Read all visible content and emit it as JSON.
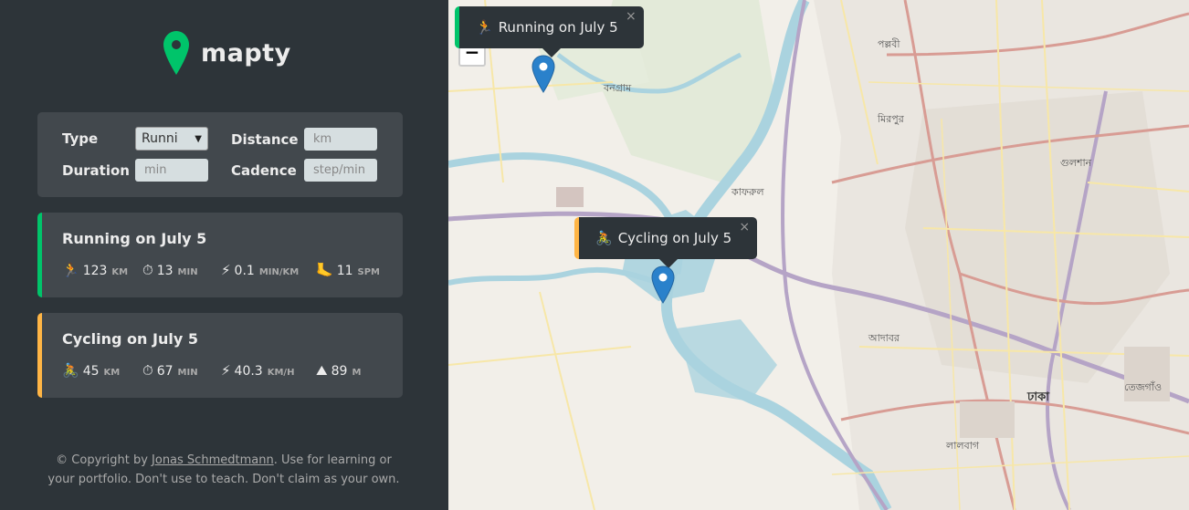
{
  "app": {
    "name": "mapty"
  },
  "form": {
    "type_label": "Type",
    "type_value": "Runni",
    "distance_label": "Distance",
    "distance_placeholder": "km",
    "duration_label": "Duration",
    "duration_placeholder": "min",
    "cadence_label": "Cadence",
    "cadence_placeholder": "step/min"
  },
  "workouts": [
    {
      "kind": "running",
      "accent": "#00c46a",
      "title": "Running on July 5",
      "details": [
        {
          "icon": "🏃",
          "value": "123",
          "unit": "km"
        },
        {
          "icon": "⏱",
          "value": "13",
          "unit": "min"
        },
        {
          "icon": "⚡",
          "value": "0.1",
          "unit": "min/km"
        },
        {
          "icon": "🦶",
          "value": "11",
          "unit": "spm"
        }
      ]
    },
    {
      "kind": "cycling",
      "accent": "#ffb545",
      "title": "Cycling on July 5",
      "details": [
        {
          "icon": "🚴",
          "value": "45",
          "unit": "km"
        },
        {
          "icon": "⏱",
          "value": "67",
          "unit": "min"
        },
        {
          "icon": "⚡",
          "value": "40.3",
          "unit": "km/h"
        },
        {
          "icon": "⛰",
          "value": "89",
          "unit": "m"
        }
      ]
    }
  ],
  "copyright": {
    "prefix": "© Copyright by ",
    "author": "Jonas Schmedtmann",
    "suffix": ". Use for learning or your portfolio. Don't use to teach. Don't claim as your own."
  },
  "map": {
    "zoom_in": "+",
    "zoom_out": "−",
    "popups": [
      {
        "title": "Running on July 5",
        "icon": "🏃",
        "close": "×"
      },
      {
        "title": "Cycling on July 5",
        "icon": "🚴",
        "close": "×"
      }
    ],
    "labels": [
      "পল্লবী",
      "মিরপুর",
      "কাফরুল",
      "ঢাকা",
      "গুলশান",
      "বনগ্রাম",
      "আদাবর",
      "তেজগাঁও",
      "লালবাগ"
    ]
  },
  "colors": {
    "sidebar_bg": "#2d3439",
    "card_bg": "#42484d",
    "running": "#00c46a",
    "cycling": "#ffb545",
    "text": "#ececec"
  }
}
